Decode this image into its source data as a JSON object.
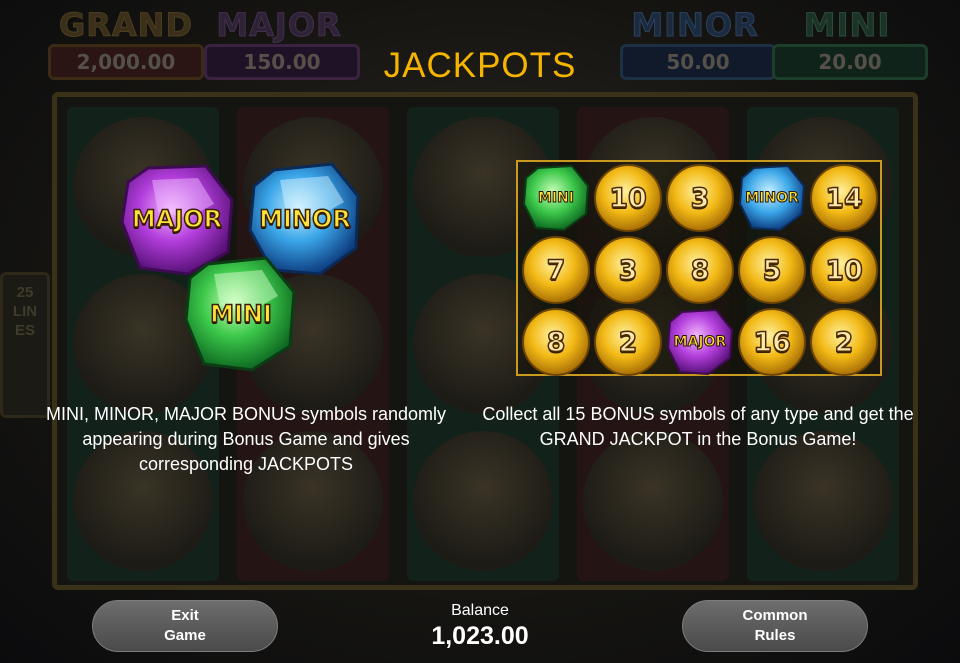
{
  "jackpots": {
    "grand": {
      "name": "GRAND",
      "value": "2,000.00"
    },
    "major": {
      "name": "MAJOR",
      "value": "150.00"
    },
    "minor": {
      "name": "MINOR",
      "value": "50.00"
    },
    "mini": {
      "name": "MINI",
      "value": "20.00"
    }
  },
  "lines_tag": "25 LINES",
  "title": "JACKPOTS",
  "gems": {
    "major": "MAJOR",
    "minor": "MINOR",
    "mini": "MINI"
  },
  "description_left": "MINI, MINOR, MAJOR BONUS symbols randomly appearing during Bonus Game and gives corresponding JACKPOTS",
  "description_right": "Collect all 15 BONUS symbols of any type and get the GRAND JACKPOT in the Bonus Game!",
  "bonus_grid": [
    [
      "MINI",
      "10",
      "3",
      "MINOR",
      "14"
    ],
    [
      "7",
      "3",
      "8",
      "5",
      "10"
    ],
    [
      "8",
      "2",
      "MAJOR",
      "16",
      "2"
    ]
  ],
  "colors": {
    "title": "#f4b400",
    "gem_major": "#b13ddb",
    "gem_minor": "#3aa6e8",
    "gem_mini": "#3cc84a",
    "coin": "#f2b915",
    "grid_border": "#c99a1e"
  },
  "buttons": {
    "exit": {
      "line1": "Exit",
      "line2": "Game"
    },
    "rules": {
      "line1": "Common",
      "line2": "Rules"
    }
  },
  "balance": {
    "label": "Balance",
    "amount": "1,023.00"
  }
}
